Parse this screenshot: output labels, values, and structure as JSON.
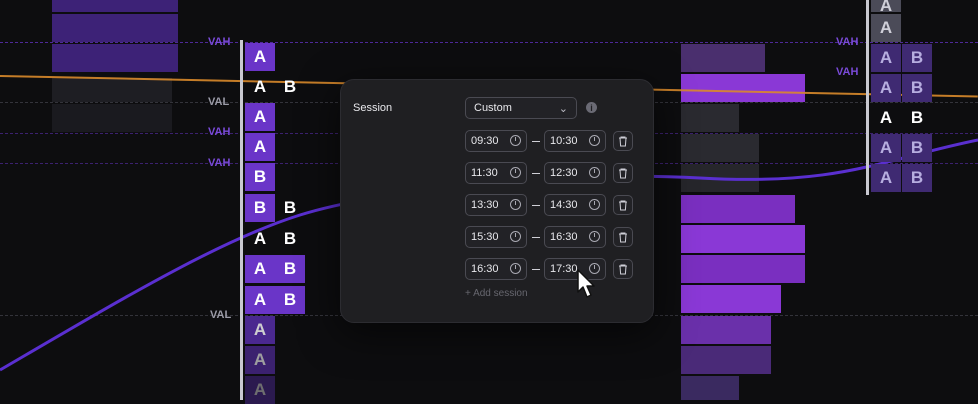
{
  "chart": {
    "tags": {
      "vah": "VAH",
      "val": "VAL"
    },
    "letters": {
      "a": "A",
      "b": "B"
    }
  },
  "session_panel": {
    "label": "Session",
    "mode": "Custom",
    "info": "i",
    "rows": [
      {
        "start": "09:30",
        "end": "10:30"
      },
      {
        "start": "11:30",
        "end": "12:30"
      },
      {
        "start": "13:30",
        "end": "14:30"
      },
      {
        "start": "15:30",
        "end": "16:30"
      },
      {
        "start": "16:30",
        "end": "17:30"
      }
    ],
    "add_label": "Add session"
  },
  "colors": {
    "accent": "#6a35c8",
    "orange": "#d98a2b",
    "background": "#0d0d0f"
  }
}
